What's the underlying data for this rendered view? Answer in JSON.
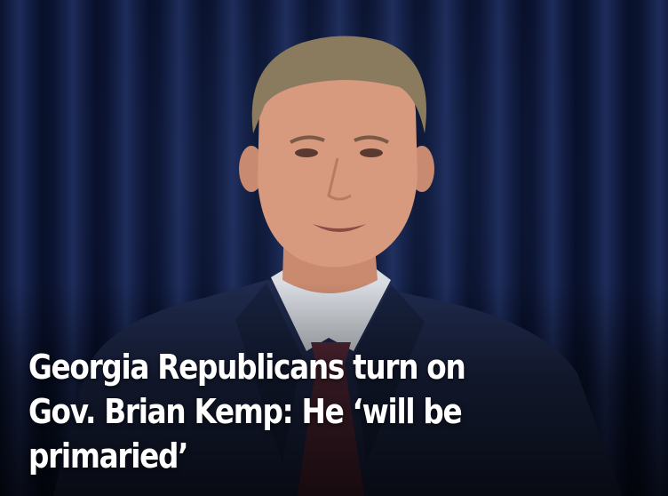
{
  "headline": {
    "lines": [
      "Georgia Republicans turn on",
      "Gov. Brian Kemp: He ‘will be",
      "primaried’"
    ]
  },
  "photo": {
    "subject_icon": "person-at-podium",
    "colors": {
      "curtain": "#16224a",
      "suit": "#1f2a4d",
      "shirt": "#d9dde3",
      "tie": "#5a2a3a",
      "skin": "#d79a7e",
      "hair": "#8a7a5e",
      "headline_text": "#ffffff"
    }
  }
}
